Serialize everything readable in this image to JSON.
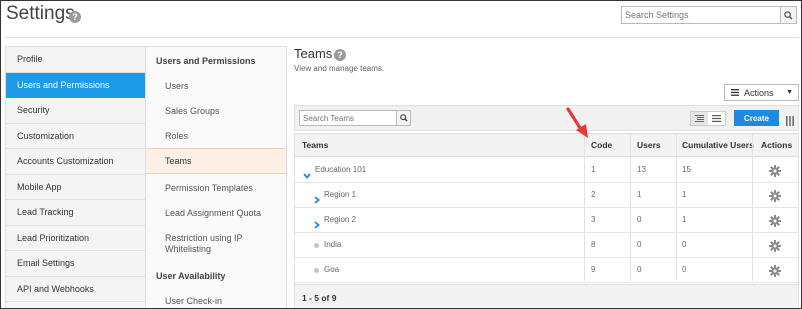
{
  "header": {
    "title": "Settings",
    "help_icon": "?",
    "search_placeholder": "Search Settings"
  },
  "sidebar": {
    "items": [
      {
        "label": "Profile",
        "active": false
      },
      {
        "label": "Users and Permissions",
        "active": true
      },
      {
        "label": "Security",
        "active": false
      },
      {
        "label": "Customization",
        "active": false
      },
      {
        "label": "Accounts Customization",
        "active": false
      },
      {
        "label": "Mobile App",
        "active": false
      },
      {
        "label": "Lead Tracking",
        "active": false
      },
      {
        "label": "Lead Prioritization",
        "active": false
      },
      {
        "label": "Email Settings",
        "active": false
      },
      {
        "label": "API and Webhooks",
        "active": false
      }
    ]
  },
  "subnav": {
    "heading": "Users and Permissions",
    "items": [
      {
        "label": "Users",
        "active": false
      },
      {
        "label": "Sales Groups",
        "active": false
      },
      {
        "label": "Roles",
        "active": false
      },
      {
        "label": "Teams",
        "active": true
      },
      {
        "label": "Permission Templates",
        "active": false
      },
      {
        "label": "Lead Assignment Quota",
        "active": false
      },
      {
        "label": "Restriction using IP Whitelisting",
        "active": false
      }
    ],
    "heading2": "User Availability",
    "items2": [
      {
        "label": "User Check-in",
        "active": false
      }
    ]
  },
  "main": {
    "title": "Teams",
    "subtitle": "View and manage teams.",
    "actions_label": "Actions",
    "search_placeholder": "Search Teams",
    "create_label": "Create",
    "columns": [
      "Teams",
      "Code",
      "Users",
      "Cumulative Users",
      "Actions"
    ],
    "rows": [
      {
        "name": "Education 101",
        "code": "1",
        "users": "13",
        "cumulative": "15",
        "marker": "chevron-down"
      },
      {
        "name": "Region 1",
        "code": "2",
        "users": "1",
        "cumulative": "1",
        "marker": "chevron-right"
      },
      {
        "name": "Region 2",
        "code": "3",
        "users": "0",
        "cumulative": "1",
        "marker": "chevron-right"
      },
      {
        "name": "India",
        "code": "8",
        "users": "0",
        "cumulative": "0",
        "marker": "dot"
      },
      {
        "name": "Goa",
        "code": "9",
        "users": "0",
        "cumulative": "0",
        "marker": "dot"
      }
    ],
    "pagination": "1 - 5 of 9"
  },
  "colors": {
    "accent": "#1e9be6",
    "create_button": "#1e88e5",
    "annotation_arrow": "#e53935"
  },
  "icons": {
    "help": "help-icon",
    "search": "search-icon",
    "menu": "hamburger-icon",
    "list_view": "list-view-icon",
    "grid_view": "grid-view-icon",
    "columns": "columns-icon",
    "gear": "gear-icon",
    "chevron_down": "chevron-down-icon",
    "chevron_right": "chevron-right-icon"
  }
}
